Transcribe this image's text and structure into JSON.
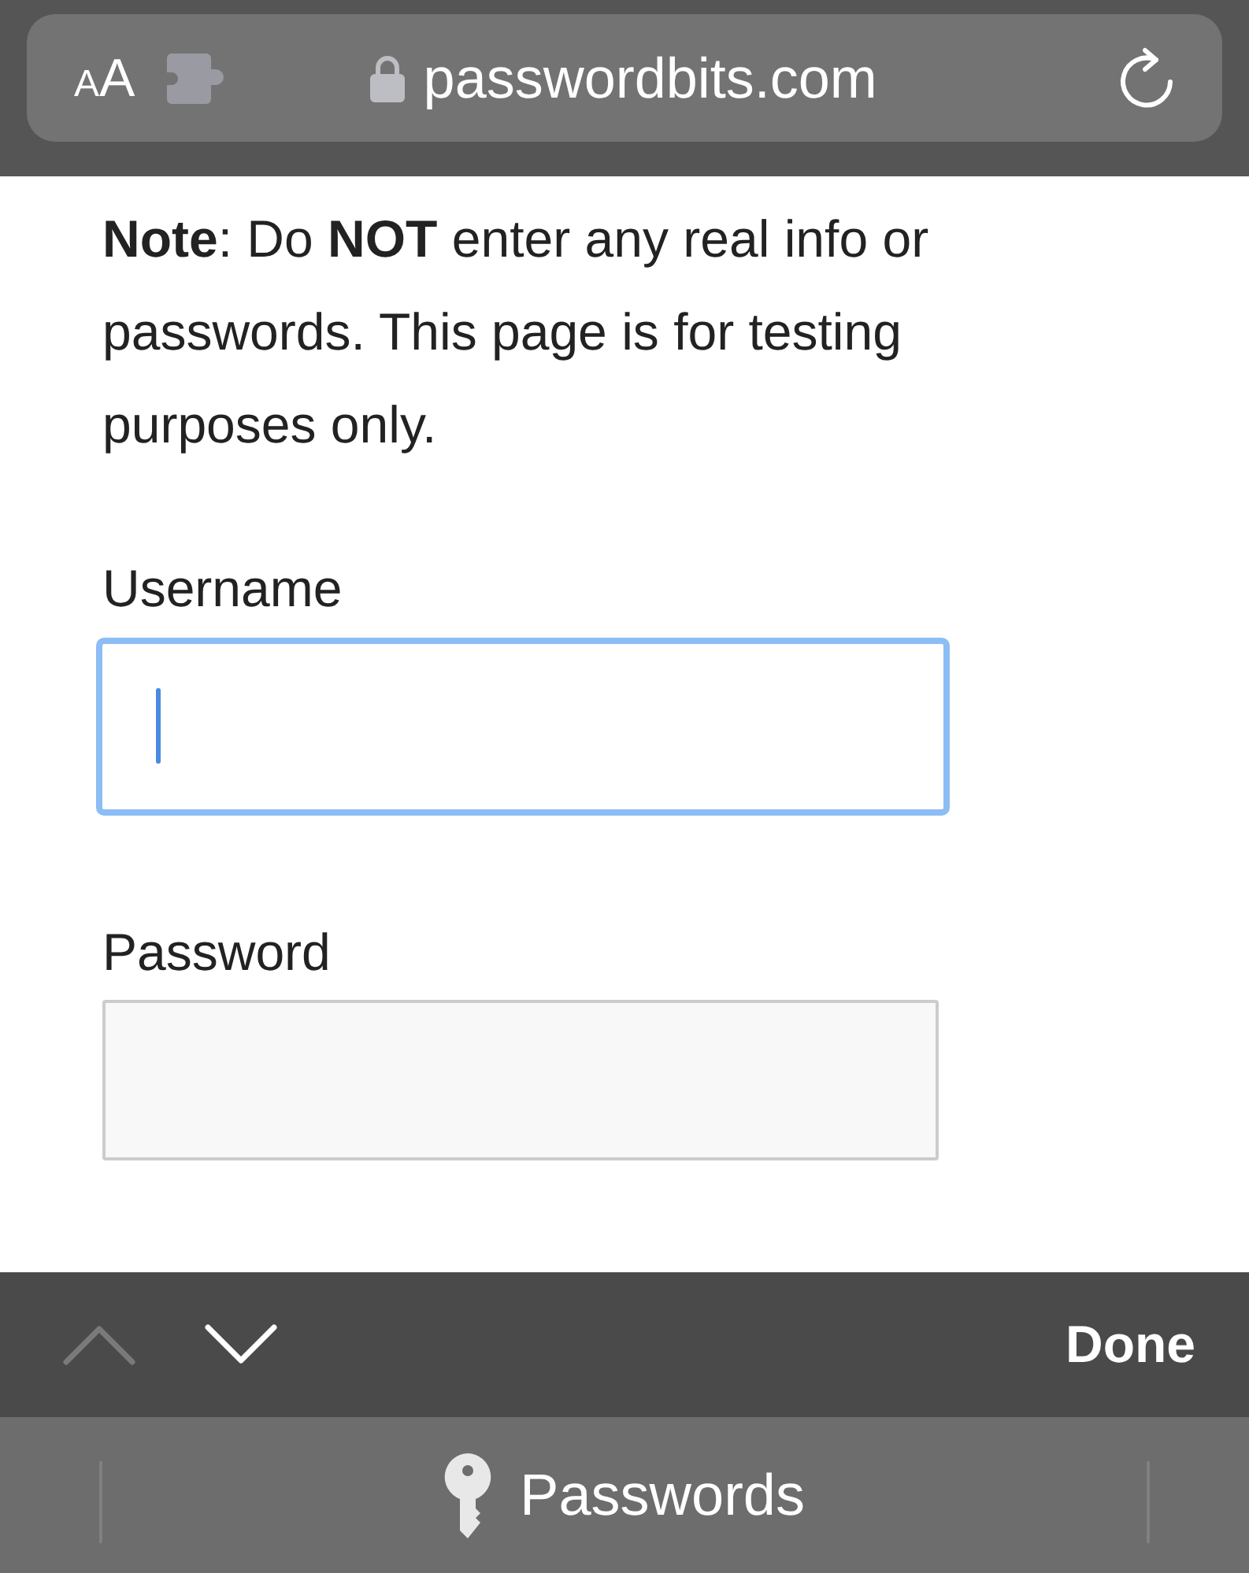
{
  "address_bar": {
    "text_size_button": "AA",
    "url": "passwordbits.com",
    "secure": true
  },
  "note": "**Note**: Do **NOT** enter any real info or passwords. This page is for testing purposes only.",
  "fields": [
    {
      "label": "Username",
      "focused": true
    },
    {
      "label": "Password",
      "focused": false
    }
  ],
  "form_toolbar": {
    "previous": {
      "disabled": true
    },
    "next": {
      "disabled": false
    },
    "done": "Done"
  },
  "suggestion_bar": {
    "label": "Passwords"
  }
}
